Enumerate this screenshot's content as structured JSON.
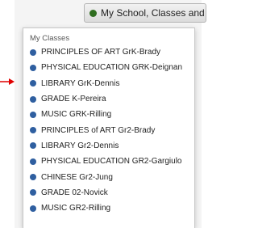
{
  "header": {
    "group_selector_label": "My School, Classes and Groups"
  },
  "menu": {
    "section_title": "My Classes",
    "items": [
      {
        "label": "PRINCIPLES OF ART GrK-Brady"
      },
      {
        "label": "PHYSICAL EDUCATION GRK-Deignan"
      },
      {
        "label": "LIBRARY GrK-Dennis"
      },
      {
        "label": "GRADE K-Pereira"
      },
      {
        "label": "MUSIC GRK-Rilling"
      },
      {
        "label": "PRINCIPLES of ART Gr2-Brady"
      },
      {
        "label": "LIBRARY Gr2-Dennis"
      },
      {
        "label": "PHYSICAL EDUCATION GR2-Gargiulo"
      },
      {
        "label": "CHINESE Gr2-Jung"
      },
      {
        "label": "GRADE 02-Novick"
      },
      {
        "label": "MUSIC GR2-Rilling"
      }
    ]
  },
  "colors": {
    "selector_dot": "#2f6d1f",
    "item_dot": "#2f5fa0",
    "pointer_arrow": "#e00000"
  }
}
